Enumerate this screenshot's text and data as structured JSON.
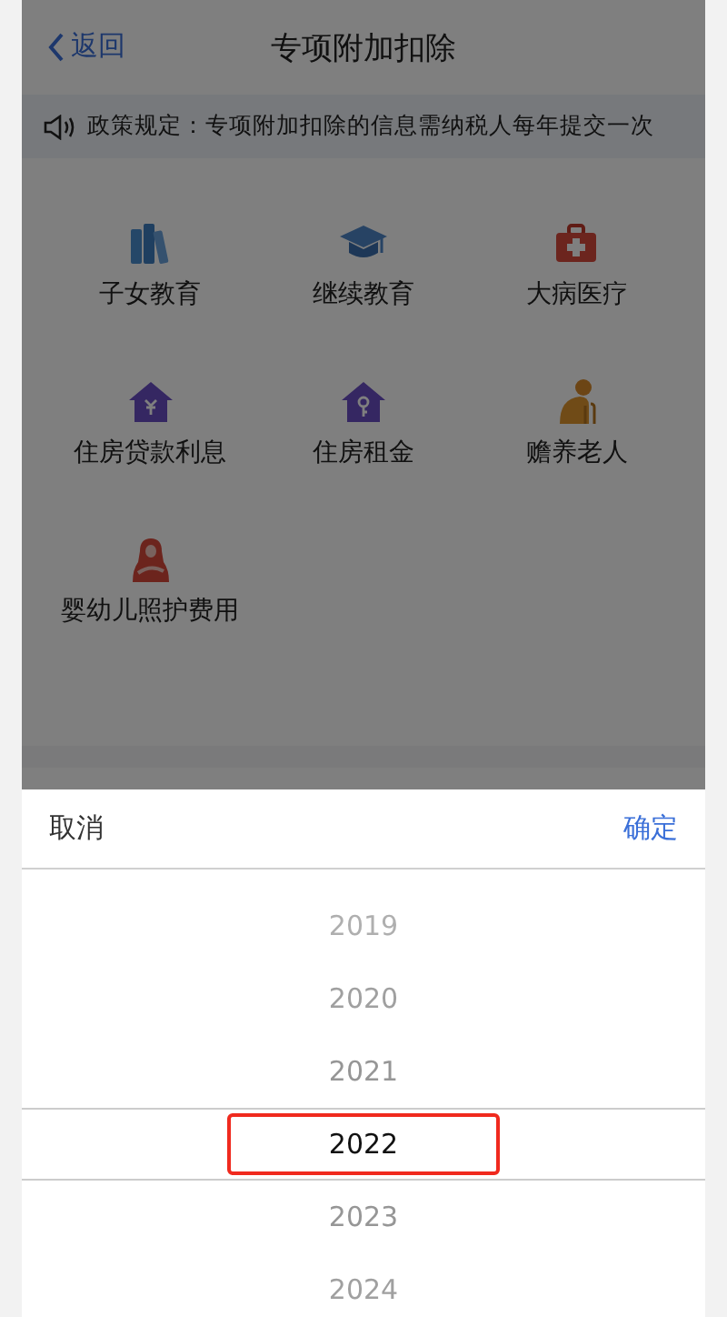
{
  "nav": {
    "back": "返回",
    "title": "专项附加扣除"
  },
  "notice": "政策规定：专项附加扣除的信息需纳税人每年提交一次",
  "categories": [
    {
      "label": "子女教育"
    },
    {
      "label": "继续教育"
    },
    {
      "label": "大病医疗"
    },
    {
      "label": "住房贷款利息"
    },
    {
      "label": "住房租金"
    },
    {
      "label": "赡养老人"
    },
    {
      "label": "婴幼儿照护费用"
    }
  ],
  "picker": {
    "cancel": "取消",
    "confirm": "确定",
    "years": [
      {
        "label": "2019",
        "selected": false
      },
      {
        "label": "2020",
        "selected": false
      },
      {
        "label": "2021",
        "selected": false
      },
      {
        "label": "2022",
        "selected": true
      },
      {
        "label": "2023",
        "selected": false
      },
      {
        "label": "2024",
        "selected": false
      }
    ]
  }
}
